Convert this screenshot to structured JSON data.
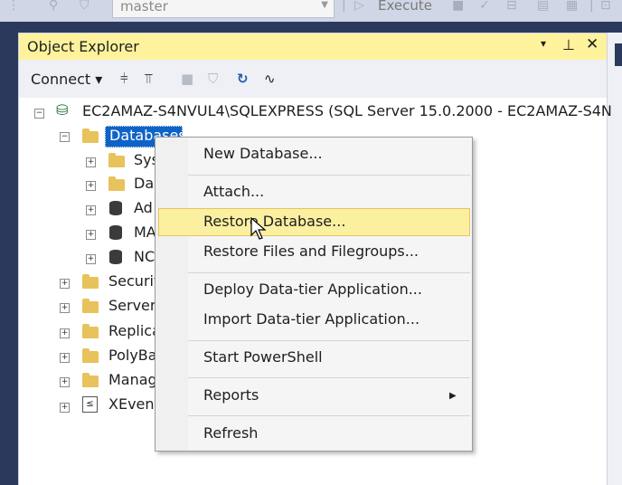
{
  "toolbar": {
    "database_value": "master",
    "execute_label": "Execute",
    "icons": [
      "filter-icon",
      "parse-icon",
      "stop-icon",
      "check-icon",
      "query-plan-icon",
      "results-grid-icon",
      "results-text-icon"
    ]
  },
  "panel": {
    "title": "Object Explorer",
    "controls": "▾ ⊥ ✕",
    "connect_label": "Connect ▾",
    "toolbar_icons": [
      "connect-icon",
      "disconnect-icon",
      "stop-icon",
      "filter-icon",
      "refresh-icon",
      "activity-monitor-icon"
    ]
  },
  "tree": {
    "server": "EC2AMAZ-S4NVUL4\\SQLEXPRESS (SQL Server 15.0.2000 - EC2AMAZ-S4N",
    "databases": "Databases",
    "db_children": [
      "Sys",
      "Da",
      "Ad",
      "MA",
      "NC"
    ],
    "server_children": [
      "Securit",
      "Server",
      "Replica",
      "PolyBa",
      "Manag",
      "XEvent"
    ]
  },
  "context_menu": {
    "items": [
      "New Database...",
      "Attach...",
      "Restore Database...",
      "Restore Files and Filegroups...",
      "Deploy Data-tier Application...",
      "Import Data-tier Application...",
      "Start PowerShell",
      "Reports",
      "Refresh"
    ],
    "highlighted": "Restore Database..."
  },
  "colors": {
    "accent_selection": "#0e63c7",
    "title_bar": "#fff29d",
    "menu_highlight": "#fbf0a0",
    "folder": "#e8c25a",
    "background": "#2b3a5c"
  }
}
